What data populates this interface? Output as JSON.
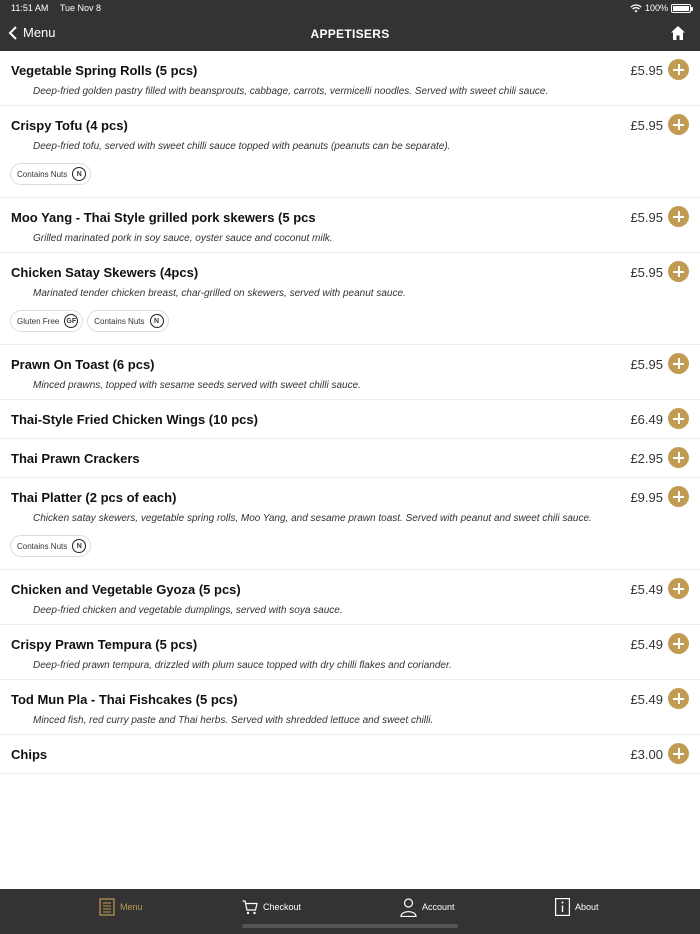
{
  "status_bar": {
    "time": "11:51 AM",
    "date": "Tue Nov 8",
    "battery": "100%"
  },
  "nav": {
    "back_label": "Menu",
    "title": "APPETISERS"
  },
  "items": [
    {
      "name": "Vegetable Spring Rolls (5 pcs)",
      "price": "£5.95",
      "description": "Deep-fried golden pastry filled with beansprouts, cabbage, carrots, vermicelli noodles. Served with sweet chili sauce.",
      "tags": []
    },
    {
      "name": "Crispy Tofu (4 pcs)",
      "price": "£5.95",
      "description": "Deep-fried tofu, served with sweet chilli sauce topped with peanuts (peanuts can be separate).",
      "tags": [
        {
          "label": "Contains Nuts",
          "badge": "N"
        }
      ]
    },
    {
      "name": "Moo Yang - Thai Style grilled pork skewers (5 pcs",
      "price": "£5.95",
      "description": "Grilled marinated pork in soy sauce, oyster sauce and coconut milk.",
      "tags": []
    },
    {
      "name": "Chicken Satay Skewers (4pcs)",
      "price": "£5.95",
      "description": "Marinated tender chicken breast, char-grilled on skewers, served with peanut sauce.",
      "tags": [
        {
          "label": "Gluten Free",
          "badge": "GF"
        },
        {
          "label": "Contains Nuts",
          "badge": "N"
        }
      ]
    },
    {
      "name": "Prawn On Toast (6 pcs)",
      "price": "£5.95",
      "description": "Minced prawns, topped with sesame seeds served with sweet chilli sauce.",
      "tags": []
    },
    {
      "name": "Thai-Style Fried Chicken Wings (10 pcs)",
      "price": "£6.49",
      "description": "",
      "tags": []
    },
    {
      "name": "Thai Prawn Crackers",
      "price": "£2.95",
      "description": "",
      "tags": []
    },
    {
      "name": "Thai Platter (2 pcs of each)",
      "price": "£9.95",
      "description": "Chicken satay skewers, vegetable spring rolls, Moo Yang, and sesame prawn toast. Served with peanut and sweet chili sauce.",
      "tags": [
        {
          "label": "Contains Nuts",
          "badge": "N"
        }
      ]
    },
    {
      "name": "Chicken and Vegetable Gyoza (5 pcs)",
      "price": "£5.49",
      "description": "Deep-fried chicken and vegetable dumplings, served with soya sauce.",
      "tags": []
    },
    {
      "name": "Crispy Prawn Tempura (5 pcs)",
      "price": "£5.49",
      "description": "Deep-fried prawn tempura, drizzled with plum sauce topped with dry chilli flakes and coriander.",
      "tags": []
    },
    {
      "name": "Tod Mun Pla - Thai Fishcakes (5 pcs)",
      "price": "£5.49",
      "description": "Minced fish, red curry paste and Thai herbs. Served with shredded lettuce and sweet chilli.",
      "tags": []
    },
    {
      "name": "Chips",
      "price": "£3.00",
      "description": "",
      "tags": []
    }
  ],
  "tabs": [
    {
      "label": "Menu",
      "icon": "menu-list-icon",
      "active": true
    },
    {
      "label": "Checkout",
      "icon": "cart-icon",
      "active": false
    },
    {
      "label": "Account",
      "icon": "person-icon",
      "active": false
    },
    {
      "label": "About",
      "icon": "info-icon",
      "active": false
    }
  ],
  "colors": {
    "bar": "#333333",
    "accent": "#c19b52"
  }
}
